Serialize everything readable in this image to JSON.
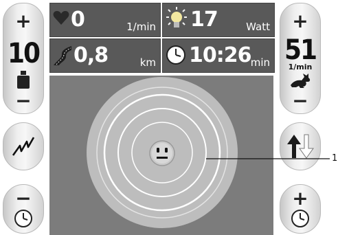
{
  "left_panel": {
    "plus_label": "+",
    "level_value": "10",
    "minus_label": "−"
  },
  "right_panel": {
    "plus_label": "+",
    "cadence_value": "51",
    "cadence_unit": "1/min",
    "minus_label": "−"
  },
  "stats": {
    "heart_rate": {
      "value": "0",
      "unit": "1/min"
    },
    "power": {
      "value": "17",
      "unit": "Watt"
    },
    "distance": {
      "value": "0,8",
      "unit": "km"
    },
    "time": {
      "value": "10:26",
      "unit": "min"
    }
  },
  "left_buttons": {
    "time_minus_label": "−"
  },
  "right_buttons": {
    "time_plus_label": "+"
  },
  "callout": {
    "label": "1"
  },
  "colors": {
    "panel": "#595959",
    "target": "#bdbdbd",
    "ring": "#ffffff",
    "main_bg": "#7c7c7c"
  }
}
